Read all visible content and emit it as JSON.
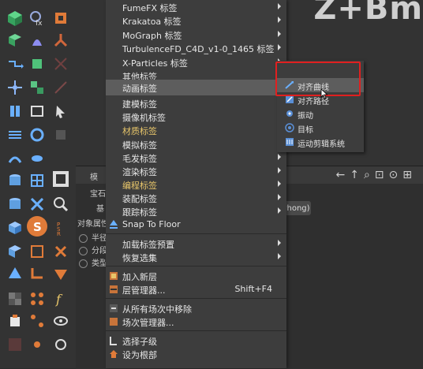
{
  "brand_text": "Z+Bm",
  "menu": {
    "items": [
      {
        "label": "FumeFX 标签",
        "submenu": true
      },
      {
        "label": "Krakatoa 标签",
        "submenu": true
      },
      {
        "label": "MoGraph 标签",
        "submenu": true
      },
      {
        "label": "TurbulenceFD_C4D_v1-0_1465 标签",
        "submenu": true
      },
      {
        "label": "X-Particles 标签",
        "submenu": true
      },
      {
        "label": "其他标签",
        "submenu": true
      },
      {
        "label": "动画标签",
        "submenu": true,
        "highlighted": true
      },
      {
        "label": "建模标签",
        "submenu": true
      },
      {
        "label": "摄像机标签",
        "submenu": true
      },
      {
        "label": "材质标签",
        "submenu": true,
        "color": "yellow"
      },
      {
        "label": "模拟标签",
        "submenu": true
      },
      {
        "label": "毛发标签",
        "submenu": true
      },
      {
        "label": "渲染标签",
        "submenu": true
      },
      {
        "label": "编程标签",
        "submenu": true,
        "color": "yellow"
      },
      {
        "label": "装配标签",
        "submenu": true
      },
      {
        "label": "跟踪标签",
        "submenu": true
      },
      {
        "label": "Snap To Floor",
        "submenu": false,
        "icon": "snap-to-floor-icon"
      },
      {
        "label": "加载标签预置",
        "submenu": true
      },
      {
        "label": "恢复选集",
        "submenu": true
      },
      {
        "label": "加入新层",
        "submenu": false,
        "icon": "layer-add-icon"
      },
      {
        "label": "层管理器...",
        "submenu": false,
        "icon": "layer-manager-icon",
        "shortcut": "Shift+F4"
      },
      {
        "label": "从所有场次中移除",
        "submenu": false,
        "icon": "take-remove-icon"
      },
      {
        "label": "场次管理器...",
        "submenu": false,
        "icon": "take-manager-icon"
      },
      {
        "label": "选择子级",
        "submenu": false,
        "icon": "select-children-icon"
      },
      {
        "label": "设为根部",
        "submenu": false,
        "icon": "set-as-root-icon"
      }
    ]
  },
  "submenu": {
    "items": [
      {
        "label": "对齐曲线",
        "icon": "align-to-spline-icon",
        "highlighted": true
      },
      {
        "label": "对齐路径",
        "icon": "align-to-path-icon"
      },
      {
        "label": "振动",
        "icon": "vibrate-icon"
      },
      {
        "label": "目标",
        "icon": "target-icon"
      },
      {
        "label": "运动剪辑系统",
        "icon": "motion-system-icon"
      }
    ]
  },
  "attr_panel": {
    "tab_label": "模",
    "object_label": "宝石",
    "mode_label": "基",
    "section_label": "对象属性",
    "fields": [
      "半径",
      "分段",
      "类型"
    ],
    "tag_value": "Phong)"
  },
  "colors": {
    "highlight_box": "#e02020",
    "accent_yellow": "#e8c66a"
  }
}
